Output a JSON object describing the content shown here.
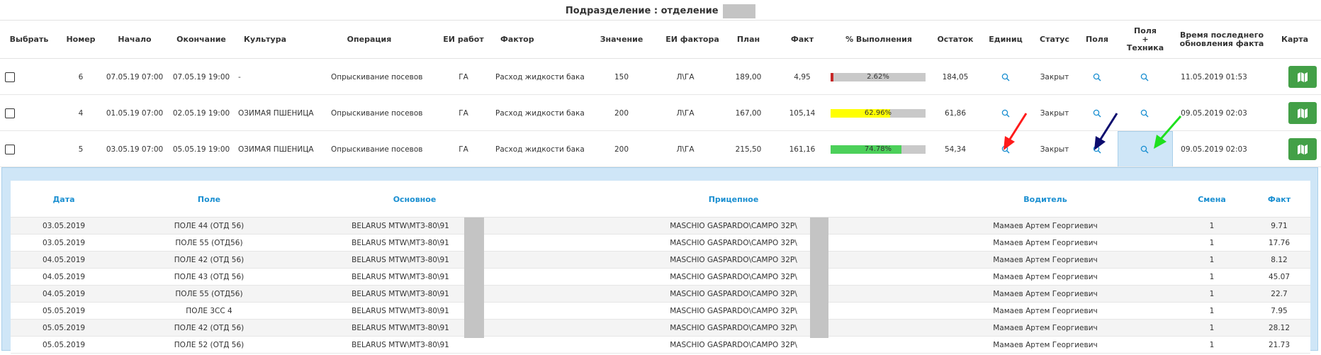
{
  "page": {
    "title": "Подразделение : отделение"
  },
  "columns": {
    "select": "Выбрать",
    "number": "Номер",
    "start": "Начало",
    "end": "Окончание",
    "culture": "Культура",
    "operation": "Операция",
    "work_unit": "ЕИ работ",
    "factor": "Фактор",
    "value": "Значение",
    "factor_unit": "ЕИ фактора",
    "plan": "План",
    "fact": "Факт",
    "percent": "% Выполнения",
    "remainder": "Остаток",
    "units": "Единиц",
    "status": "Статус",
    "fields": "Поля",
    "fields_tech": "Поля\n+\nТехника",
    "last_update": "Время последнего\nобновления факта",
    "map": "Карта"
  },
  "rows": [
    {
      "number": "6",
      "start": "07.05.19 07:00",
      "end": "07.05.19 19:00",
      "culture": "-",
      "operation": "Опрыскивание посевов",
      "work_unit": "ГА",
      "factor": "Расход жидкости бака",
      "value": "150",
      "factor_unit": "Л\\ГА",
      "plan": "189,00",
      "fact": "4,95",
      "percent": 2.62,
      "percent_label": "2.62%",
      "bar_color": "#c62828",
      "remainder": "184,05",
      "status": "Закрыт",
      "last_update": "11.05.2019 01:53"
    },
    {
      "number": "4",
      "start": "01.05.19 07:00",
      "end": "02.05.19 19:00",
      "culture": "ОЗИМАЯ ПШЕНИЦА",
      "operation": "Опрыскивание посевов",
      "work_unit": "ГА",
      "factor": "Расход жидкости бака",
      "value": "200",
      "factor_unit": "Л\\ГА",
      "plan": "167,00",
      "fact": "105,14",
      "percent": 62.96,
      "percent_label": "62.96%",
      "bar_color": "#ffff00",
      "remainder": "61,86",
      "status": "Закрыт",
      "last_update": "09.05.2019 02:03"
    },
    {
      "number": "5",
      "start": "03.05.19 07:00",
      "end": "05.05.19 19:00",
      "culture": "ОЗИМАЯ ПШЕНИЦА",
      "operation": "Опрыскивание посевов",
      "work_unit": "ГА",
      "factor": "Расход жидкости бака",
      "value": "200",
      "factor_unit": "Л\\ГА",
      "plan": "215,50",
      "fact": "161,16",
      "percent": 74.78,
      "percent_label": "74.78%",
      "bar_color": "#4cd05a",
      "remainder": "54,34",
      "status": "Закрыт",
      "last_update": "09.05.2019 02:03"
    }
  ],
  "detail": {
    "columns": {
      "date": "Дата",
      "field": "Поле",
      "main": "Основное",
      "trailer": "Прицепное",
      "driver": "Водитель",
      "shift": "Смена",
      "fact": "Факт"
    },
    "rows": [
      {
        "date": "03.05.2019",
        "field": "ПОЛЕ 44 (ОТД 56)",
        "main": "BELARUS MTW\\МТЗ-80\\91",
        "trailer": "MASCHIO GASPARDO\\CAMPO 32P\\",
        "driver": "Мамаев Артем Георгиевич",
        "shift": "1",
        "fact": "9.71"
      },
      {
        "date": "03.05.2019",
        "field": "ПОЛЕ 55 (ОТД56)",
        "main": "BELARUS MTW\\МТЗ-80\\91",
        "trailer": "MASCHIO GASPARDO\\CAMPO 32P\\",
        "driver": "Мамаев Артем Георгиевич",
        "shift": "1",
        "fact": "17.76"
      },
      {
        "date": "04.05.2019",
        "field": "ПОЛЕ 42 (ОТД 56)",
        "main": "BELARUS MTW\\МТЗ-80\\91",
        "trailer": "MASCHIO GASPARDO\\CAMPO 32P\\",
        "driver": "Мамаев Артем Георгиевич",
        "shift": "1",
        "fact": "8.12"
      },
      {
        "date": "04.05.2019",
        "field": "ПОЛЕ 43 (ОТД 56)",
        "main": "BELARUS MTW\\МТЗ-80\\91",
        "trailer": "MASCHIO GASPARDO\\CAMPO 32P\\",
        "driver": "Мамаев Артем Георгиевич",
        "shift": "1",
        "fact": "45.07"
      },
      {
        "date": "04.05.2019",
        "field": "ПОЛЕ 55 (ОТД56)",
        "main": "BELARUS MTW\\МТЗ-80\\91",
        "trailer": "MASCHIO GASPARDO\\CAMPO 32P\\",
        "driver": "Мамаев Артем Георгиевич",
        "shift": "1",
        "fact": "22.7"
      },
      {
        "date": "05.05.2019",
        "field": "ПОЛЕ 3СС 4",
        "main": "BELARUS MTW\\МТЗ-80\\91",
        "trailer": "MASCHIO GASPARDO\\CAMPO 32P\\",
        "driver": "Мамаев Артем Георгиевич",
        "shift": "1",
        "fact": "7.95"
      },
      {
        "date": "05.05.2019",
        "field": "ПОЛЕ 42 (ОТД 56)",
        "main": "BELARUS MTW\\МТЗ-80\\91",
        "trailer": "MASCHIO GASPARDO\\CAMPO 32P\\",
        "driver": "Мамаев Артем Георгиевич",
        "shift": "1",
        "fact": "28.12"
      },
      {
        "date": "05.05.2019",
        "field": "ПОЛЕ 52 (ОТД 56)",
        "main": "BELARUS MTW\\МТЗ-80\\91",
        "trailer": "MASCHIO GASPARDO\\CAMPO 32P\\",
        "driver": "Мамаев Артем Георгиевич",
        "shift": "1",
        "fact": "21.73"
      }
    ]
  },
  "colors": {
    "accent": "#1a8fd1",
    "map_button": "#43a047",
    "panel_bg": "#cfe6f7",
    "arrow_red": "#ff1a1a",
    "arrow_navy": "#0b0b6e",
    "arrow_green": "#1ee01e"
  },
  "icons": {
    "search": "magnifier-icon",
    "map": "map-icon",
    "annotation": "arrow-icon"
  }
}
